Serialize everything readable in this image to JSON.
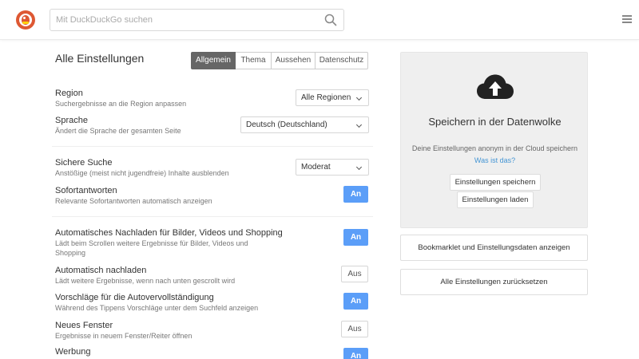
{
  "header": {
    "search_placeholder": "Mit DuckDuckGo suchen",
    "logo_icon": "duckduckgo-logo",
    "search_icon": "magnifier-icon",
    "menu_icon": "hamburger-icon"
  },
  "settings": {
    "title": "Alle Einstellungen",
    "tabs": [
      {
        "label": "Allgemein",
        "active": true
      },
      {
        "label": "Thema",
        "active": false
      },
      {
        "label": "Aussehen",
        "active": false
      },
      {
        "label": "Datenschutz",
        "active": false
      }
    ],
    "rows": {
      "region": {
        "label": "Region",
        "desc": "Suchergebnisse an die Region anpassen",
        "value": "Alle Regionen"
      },
      "sprache": {
        "label": "Sprache",
        "desc": "Ändert die Sprache der gesamten Seite",
        "value": "Deutsch (Deutschland)"
      },
      "sichere_suche": {
        "label": "Sichere Suche",
        "desc": "Anstößige (meist nicht jugendfreie) Inhalte ausblenden",
        "value": "Moderat"
      },
      "sofortantworten": {
        "label": "Sofortantworten",
        "desc": "Relevante Sofortantworten automatisch anzeigen",
        "value": "An"
      },
      "auto_nachladen_medien": {
        "label": "Automatisches Nachladen für Bilder, Videos und Shopping",
        "desc_line1": "Lädt beim Scrollen weitere Ergebnisse für Bilder, Videos und",
        "desc_line2": "Shopping",
        "value": "An"
      },
      "auto_nachladen": {
        "label": "Automatisch nachladen",
        "desc": "Lädt weitere Ergebnisse, wenn nach unten gescrollt wird",
        "value": "Aus"
      },
      "vorschlaege": {
        "label": "Vorschläge für die Autovervollständigung",
        "desc": "Während des Tippens Vorschläge unter dem Suchfeld anzeigen",
        "value": "An"
      },
      "neues_fenster": {
        "label": "Neues Fenster",
        "desc": "Ergebnisse in neuem Fenster/Reiter öffnen",
        "value": "Aus"
      },
      "werbung": {
        "label": "Werbung",
        "value": "An"
      }
    }
  },
  "cloud": {
    "icon": "cloud-upload-icon",
    "title": "Speichern in der Datenwolke",
    "desc": "Deine Einstellungen anonym in der Cloud speichern",
    "link": "Was ist das?",
    "save_button": "Einstellungen speichern",
    "load_button": "Einstellungen laden"
  },
  "sidebar_buttons": {
    "bookmarklet": "Bookmarklet und Einstellungsdaten anzeigen",
    "reset": "Alle Einstellungen zurücksetzen"
  },
  "colors": {
    "accent_blue": "#5b9ef8",
    "active_tab": "#666666",
    "brand_orange": "#de5833",
    "link": "#4495d4"
  }
}
